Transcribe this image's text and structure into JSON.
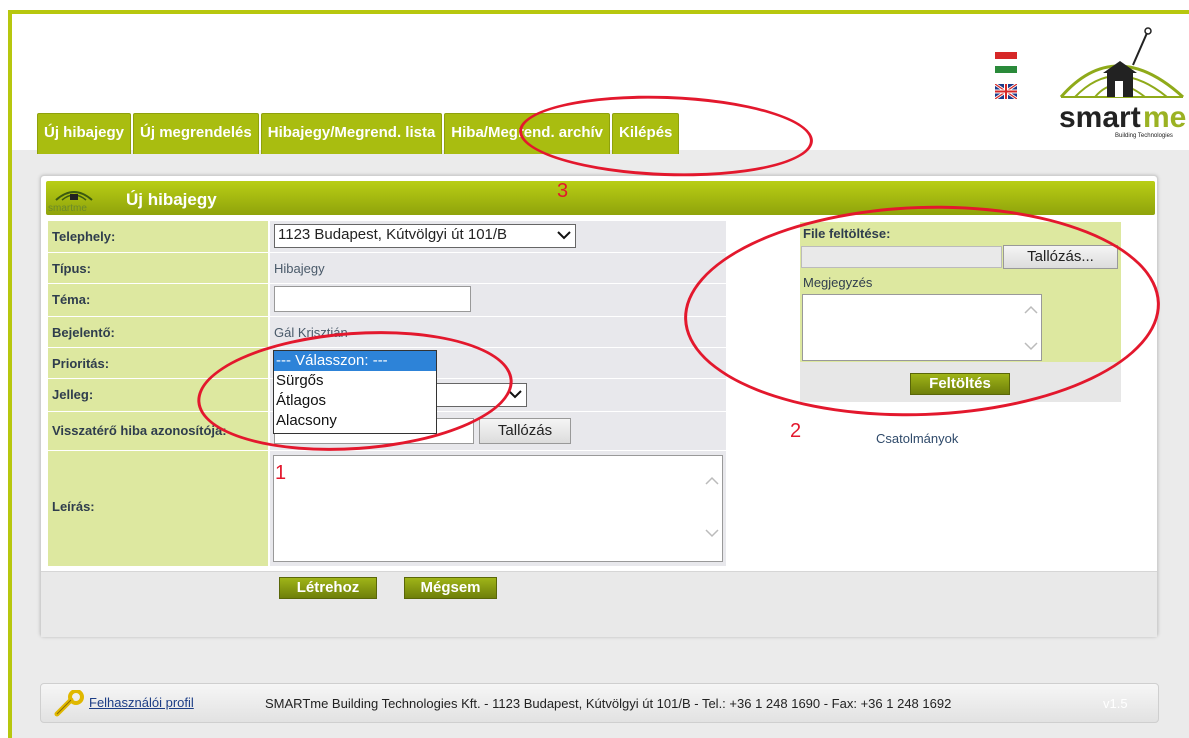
{
  "tabs": [
    "Új hibajegy",
    "Új megrendelés",
    "Hibajegy/Megrend. lista",
    "Hiba/Megrend. archív",
    "Kilépés"
  ],
  "logo": {
    "brand": "smartme",
    "tagline": "Building Technologies"
  },
  "panel": {
    "title": "Új hibajegy",
    "mini_logo_text": "smartme"
  },
  "form": {
    "telephely_label": "Telephely:",
    "telephely_value": "1123 Budapest, Kútvölgyi út 101/B",
    "tipus_label": "Típus:",
    "tipus_value": "Hibajegy",
    "tema_label": "Téma:",
    "bejelento_label": "Bejelentő:",
    "bejelento_value": "Gál Krisztián",
    "prioritas_label": "Prioritás:",
    "jelleg_label": "Jelleg:",
    "visszatero_label": "Visszatérő hiba azonosítója:",
    "visszatero_button": "Tallózás",
    "leiras_label": "Leírás:"
  },
  "priority_dropdown": {
    "options": [
      "--- Válasszon: ---",
      "Sürgős",
      "Átlagos",
      "Alacsony"
    ],
    "selected_index": 0
  },
  "buttons": {
    "create": "Létrehoz",
    "cancel": "Mégsem"
  },
  "upload": {
    "label": "File feltöltése:",
    "browse_button": "Tallózás...",
    "note_label": "Megjegyzés",
    "upload_button": "Feltöltés",
    "attachments_link": "Csatolmányok"
  },
  "footer": {
    "profile_link": "Felhasználói profil",
    "company_text": "SMARTme Building Technologies Kft. - 1123 Budapest, Kútvölgyi út 101/B - Tel.: +36 1 248 1690 - Fax: +36 1 248 1692",
    "version": "v1.5"
  },
  "annotations": [
    "1",
    "2",
    "3"
  ],
  "colors": {
    "accent": "#a9bd10",
    "annotation": "#e3182d",
    "form_label_bg": "#dde8a0"
  }
}
